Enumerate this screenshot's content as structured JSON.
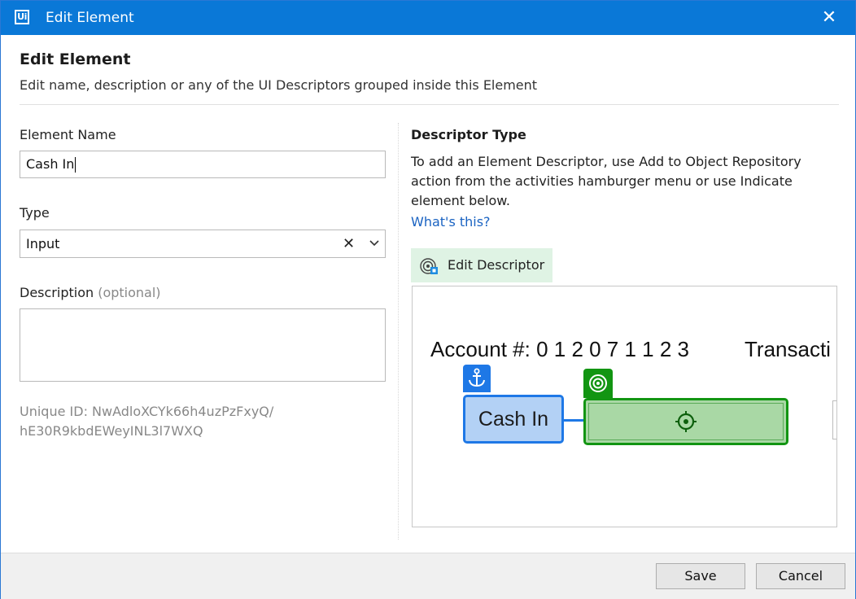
{
  "window": {
    "logo_text": "Ui",
    "title": "Edit Element",
    "close_glyph": "✕"
  },
  "header": {
    "title": "Edit Element",
    "subtitle": "Edit name, description or any of the UI Descriptors grouped inside this Element"
  },
  "form": {
    "element_name_label": "Element Name",
    "element_name_value": "Cash In",
    "type_label": "Type",
    "type_value": "Input",
    "type_clear_glyph": "✕",
    "description_label": "Description",
    "description_optional": "(optional)",
    "description_value": "",
    "unique_id_line1": "Unique ID: NwAdloXCYk66h4uzPzFxyQ/",
    "unique_id_line2": "hE30R9kbdEWeyINL3l7WXQ"
  },
  "descriptor": {
    "title": "Descriptor Type",
    "description": "To add an Element Descriptor, use Add to Object Repository action from the activities hamburger menu or use Indicate element below.",
    "link_text": "What's this?",
    "edit_button_label": "Edit Descriptor",
    "preview": {
      "background_text_left": "Account #: 0 1 2 0 7 1 1 2 3",
      "background_text_right": "Transacti",
      "anchor_label": "Cash In"
    }
  },
  "footer": {
    "save_label": "Save",
    "cancel_label": "Cancel"
  },
  "colors": {
    "titlebar": "#0a78d7",
    "anchor_blue": "#1e78e6",
    "target_green": "#129512",
    "link_blue": "#1a63c2"
  },
  "icons": {
    "close": "close-icon",
    "clear": "clear-icon",
    "dropdown": "chevron-down-icon",
    "edit_descriptor": "target-descriptor-icon",
    "anchor": "anchor-icon",
    "target": "target-icon",
    "crosshair": "crosshair-icon"
  }
}
